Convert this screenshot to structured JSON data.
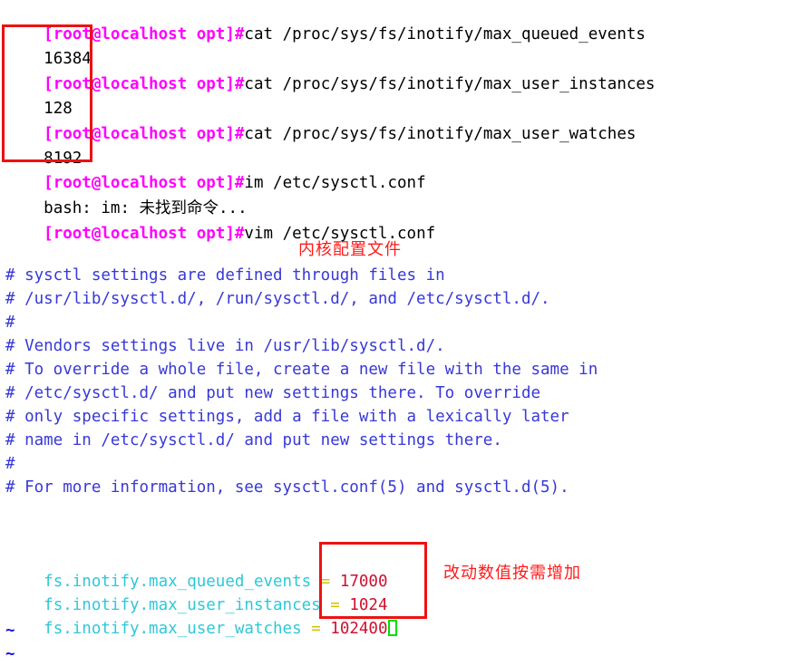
{
  "terminal": {
    "shell_prompt": "[root@localhost opt]#",
    "lines": [
      {
        "type": "command",
        "prompt": "[root@localhost opt]#",
        "command": "cat /proc/sys/fs/inotify/max_queued_events"
      },
      {
        "type": "output",
        "text": "16384"
      },
      {
        "type": "command",
        "prompt": "[root@localhost opt]#",
        "command": "cat /proc/sys/fs/inotify/max_user_instances"
      },
      {
        "type": "output",
        "text": "128"
      },
      {
        "type": "command",
        "prompt": "[root@localhost opt]#",
        "command": "cat /proc/sys/fs/inotify/max_user_watches"
      },
      {
        "type": "output",
        "text": "8192"
      },
      {
        "type": "command",
        "prompt": "[root@localhost opt]#",
        "command": "im /etc/sysctl.conf"
      },
      {
        "type": "output",
        "text": "bash: im: 未找到命令..."
      },
      {
        "type": "command",
        "prompt": "[root@localhost opt]#",
        "command": "vim /etc/sysctl.conf"
      }
    ]
  },
  "editor": {
    "comment_lines": [
      "# sysctl settings are defined through files in",
      "# /usr/lib/sysctl.d/, /run/sysctl.d/, and /etc/sysctl.d/.",
      "#",
      "# Vendors settings live in /usr/lib/sysctl.d/.",
      "# To override a whole file, create a new file with the same in",
      "# /etc/sysctl.d/ and put new settings there. To override",
      "# only specific settings, add a file with a lexically later",
      "# name in /etc/sysctl.d/ and put new settings there.",
      "#",
      "# For more information, see sysctl.conf(5) and sysctl.d(5)."
    ],
    "settings": [
      {
        "key": "fs.inotify.max_queued_events",
        "eq": "=",
        "value": "17000"
      },
      {
        "key": "fs.inotify.max_user_instances",
        "eq": "=",
        "value": "1024"
      },
      {
        "key": "fs.inotify.max_user_watches",
        "eq": "=",
        "value": "102400"
      }
    ],
    "empty_markers": [
      "~",
      "~"
    ]
  },
  "annotations": [
    {
      "id": "kernel-config-file",
      "text": "内核配置文件"
    },
    {
      "id": "change-values",
      "text": "改动数值按需增加"
    }
  ],
  "colors": {
    "prompt": "#ff00ff",
    "comment": "#3838d8",
    "key": "#2ec8d8",
    "equals": "#d4c400",
    "value": "#d01030",
    "annotation": "#ff1a1a",
    "highlight_box": "#ee1111",
    "cursor": "#00e000",
    "tilde": "#1111ee",
    "text": "#000000",
    "background": "#ffffff"
  }
}
